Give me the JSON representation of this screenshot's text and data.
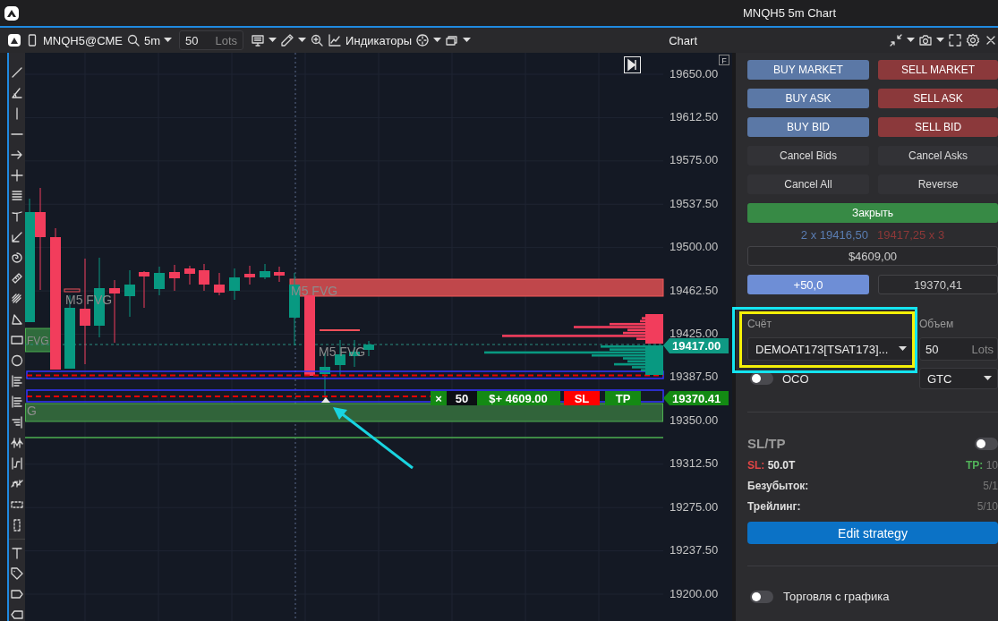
{
  "window": {
    "title": "MNQH5 5m Chart"
  },
  "toolbar": {
    "symbol": "MNQH5@CME",
    "timeframe": "5m",
    "quantity": {
      "value": "50",
      "unit": "Lots"
    },
    "indicators_label": "Индикаторы",
    "panel_title": "Chart"
  },
  "chart": {
    "price_axis": [
      "19650.00",
      "19612.50",
      "19575.00",
      "19537.50",
      "19500.00",
      "19462.50",
      "19425.00",
      "19387.50",
      "19350.00",
      "19312.50",
      "19275.00",
      "19237.50",
      "19200.00"
    ],
    "zone_labels": [
      "M5 FVG",
      "M5 FVG",
      "M5 FVG",
      "FVG",
      "G"
    ],
    "corner_badge": "F",
    "last_price_tag": "19417.00",
    "order_price_tag": "19370.41",
    "order_line": {
      "close": "×",
      "quantity": "50",
      "pnl": "$+ 4609.00",
      "sl": "SL",
      "tp": "TP"
    }
  },
  "order_panel": {
    "buttons": [
      {
        "label": "BUY MARKET",
        "kind": "buy"
      },
      {
        "label": "SELL MARKET",
        "kind": "sell"
      },
      {
        "label": "BUY ASK",
        "kind": "buy"
      },
      {
        "label": "SELL ASK",
        "kind": "sell"
      },
      {
        "label": "BUY BID",
        "kind": "buy"
      },
      {
        "label": "SELL BID",
        "kind": "sell"
      },
      {
        "label": "Cancel Bids",
        "kind": "neutral"
      },
      {
        "label": "Cancel Asks",
        "kind": "neutral"
      },
      {
        "label": "Cancel All",
        "kind": "neutral"
      },
      {
        "label": "Reverse",
        "kind": "neutral"
      },
      {
        "label": "Закрыть",
        "kind": "close"
      }
    ],
    "bid_quote": "2 x 19416,50",
    "ask_quote": "19417,25 x 3",
    "pnl": "$4609,00",
    "offset_button": "+50,0",
    "price": "19370,41",
    "account": {
      "label": "Счёт",
      "value": "DEMOAT173[TSAT173]..."
    },
    "volume": {
      "label": "Объем",
      "value": "50",
      "unit": "Lots"
    },
    "oco": {
      "label": "OCO",
      "on": false
    },
    "time_in_force": "GTC",
    "sltp": {
      "title": "SL/TP",
      "on": false,
      "sl_label": "SL:",
      "sl_value": "50.0T",
      "tp_label": "TP:",
      "tp_value": "10",
      "rows": [
        {
          "label": "Безубыток:",
          "value": "5/1"
        },
        {
          "label": "Трейлинг:",
          "value": "5/10"
        }
      ]
    },
    "edit_button": "Edit strategy",
    "chart_trading": {
      "label": "Торговля с графика",
      "on": false
    }
  }
}
